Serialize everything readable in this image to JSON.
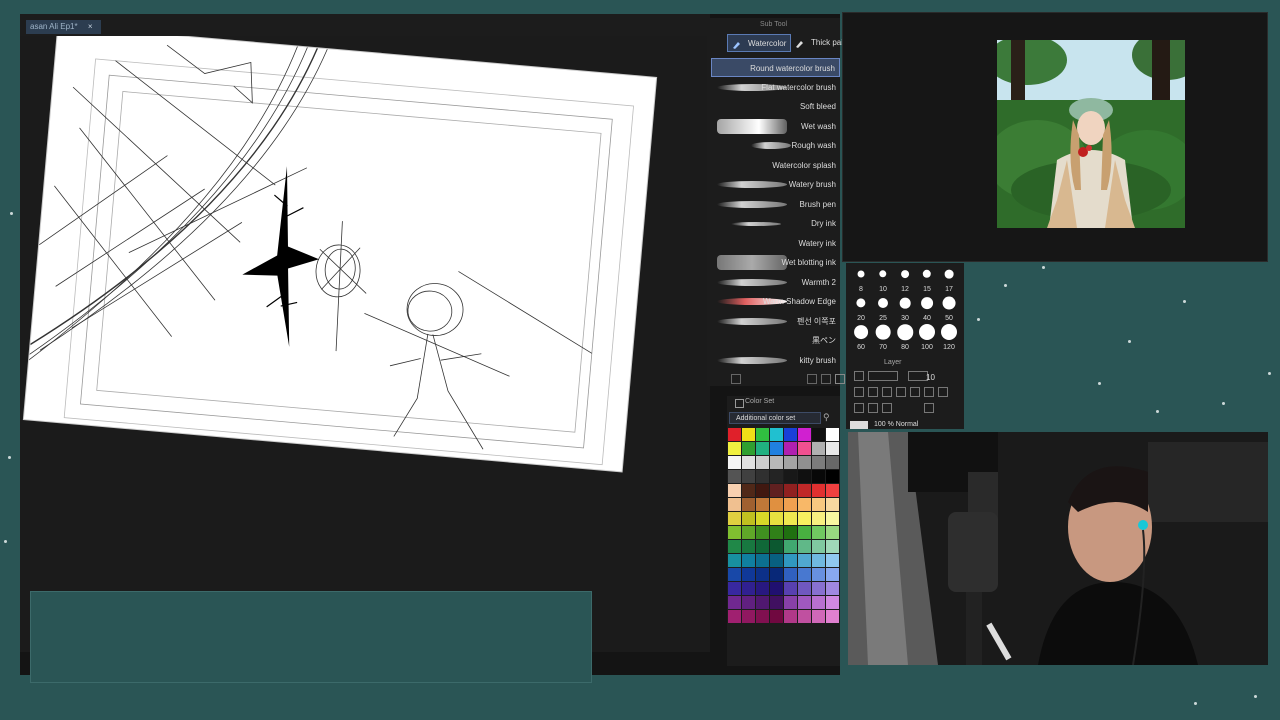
{
  "document": {
    "tab_title": "asan Ali Ep1*",
    "close_glyph": "×"
  },
  "subtool_panel": {
    "header": "Sub Tool",
    "tabs": [
      {
        "label": "Watercolor",
        "active": true
      },
      {
        "label": "Thick pai",
        "active": false
      }
    ],
    "brushes": [
      "Round watercolor brush",
      "Flat watercolor brush",
      "Soft bleed",
      "Wet wash",
      "Rough wash",
      "Watercolor splash",
      "Watery brush",
      "Brush pen",
      "Dry ink",
      "Watery ink",
      "Wet blotting ink",
      "Warmth 2",
      "Warm Shadow Edge",
      "펜선 이쪽포",
      "黒ペン",
      "kitty brush"
    ],
    "selected_brush": "Round watercolor brush"
  },
  "color_set": {
    "title": "Color Set",
    "dropdown": "Additional color set",
    "colors": [
      "#e0202a",
      "#f0e018",
      "#30c040",
      "#20c0d0",
      "#1840d8",
      "#d020d0",
      "#101010",
      "#ffffff",
      "#f0f040",
      "#30a030",
      "#20b080",
      "#2080e0",
      "#b020b0",
      "#f05090",
      "#b0b0b0",
      "#e8e8e8",
      "#f4f4f4",
      "#e0e0e0",
      "#cccccc",
      "#b8b8b8",
      "#a4a4a4",
      "#909090",
      "#7c7c7c",
      "#686868",
      "#545454",
      "#404040",
      "#303030",
      "#242424",
      "#181818",
      "#101010",
      "#080808",
      "#000000",
      "#f8d0b0",
      "#502818",
      "#401810",
      "#602020",
      "#902020",
      "#c02828",
      "#e03030",
      "#f04040",
      "#f0c090",
      "#a06030",
      "#c07838",
      "#e09040",
      "#f0a050",
      "#f8b868",
      "#f8c880",
      "#f8d8a0",
      "#e0d040",
      "#c0c020",
      "#d8d828",
      "#e8e040",
      "#f0e850",
      "#f8f060",
      "#f8f080",
      "#f8f8a0",
      "#80c030",
      "#60a828",
      "#409020",
      "#308018",
      "#207010",
      "#48b040",
      "#70c860",
      "#98d880",
      "#208848",
      "#187840",
      "#106838",
      "#0c5830",
      "#40a870",
      "#60b888",
      "#80c8a0",
      "#a0d8b8",
      "#1890a0",
      "#1080a0",
      "#0c7090",
      "#086080",
      "#3098c0",
      "#50a8d0",
      "#70b8e0",
      "#90c8f0",
      "#1848a8",
      "#103898",
      "#0c3088",
      "#082878",
      "#3060c0",
      "#4878d0",
      "#6890e0",
      "#88a8f0",
      "#3828a0",
      "#302090",
      "#281880",
      "#201070",
      "#5840b0",
      "#7058c0",
      "#8870d0",
      "#a088e0",
      "#702890",
      "#602080",
      "#501870",
      "#401060",
      "#8840a8",
      "#a058c0",
      "#b870d0",
      "#d088e0",
      "#a02070",
      "#901860",
      "#801050",
      "#700840",
      "#b03888",
      "#c050a0",
      "#d068b8",
      "#e080d0"
    ]
  },
  "brush_size_panel": {
    "sizes": [
      "8",
      "10",
      "12",
      "15",
      "17",
      "20",
      "25",
      "30",
      "40",
      "50",
      "60",
      "70",
      "80",
      "100",
      "120"
    ]
  },
  "layer_panel": {
    "title": "Layer",
    "opacity_value": "10",
    "layer_label": "100 % Normal"
  },
  "reference_window": {
    "description_hidden": ""
  },
  "webcam": {}
}
